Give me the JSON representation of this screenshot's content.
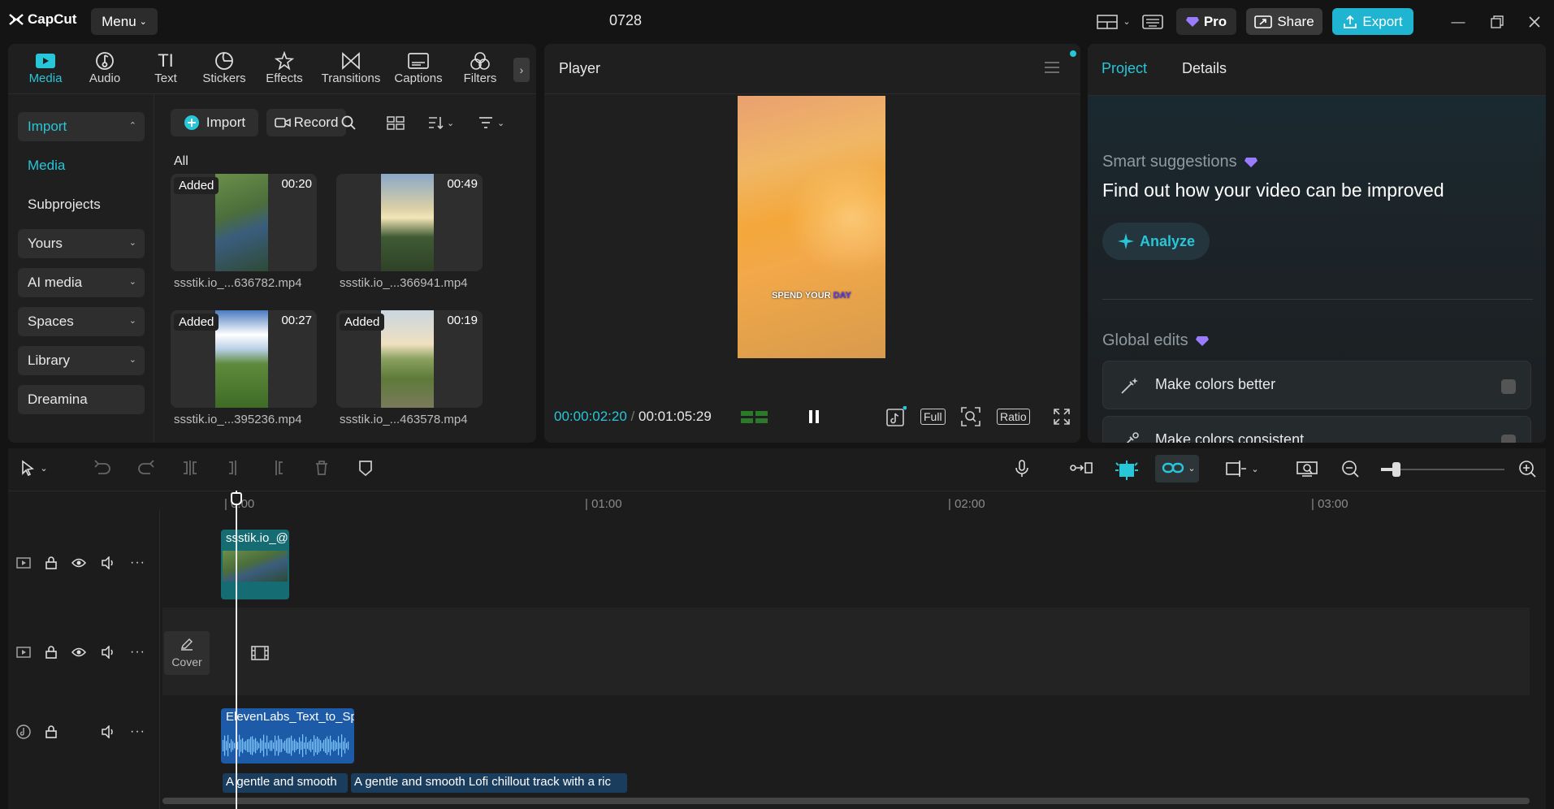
{
  "app": {
    "logo": "CapCut",
    "menu_label": "Menu",
    "project_title": "0728"
  },
  "header": {
    "pro_label": "Pro",
    "share_label": "Share",
    "export_label": "Export"
  },
  "tool_tabs": [
    {
      "label": "Media",
      "icon": "media-icon"
    },
    {
      "label": "Audio",
      "icon": "audio-icon"
    },
    {
      "label": "Text",
      "icon": "text-icon"
    },
    {
      "label": "Stickers",
      "icon": "stickers-icon"
    },
    {
      "label": "Effects",
      "icon": "effects-icon"
    },
    {
      "label": "Transitions",
      "icon": "transitions-icon"
    },
    {
      "label": "Captions",
      "icon": "captions-icon"
    },
    {
      "label": "Filters",
      "icon": "filters-icon"
    }
  ],
  "sidebar": {
    "items": [
      {
        "label": "Import"
      },
      {
        "label": "Media"
      },
      {
        "label": "Subprojects"
      },
      {
        "label": "Yours"
      },
      {
        "label": "AI media"
      },
      {
        "label": "Spaces"
      },
      {
        "label": "Library"
      },
      {
        "label": "Dreamina"
      }
    ]
  },
  "media": {
    "import_label": "Import",
    "record_label": "Record",
    "filter_all": "All",
    "items": [
      {
        "badge": "Added",
        "duration": "00:20",
        "name": "ssstik.io_...636782.mp4"
      },
      {
        "badge": "",
        "duration": "00:49",
        "name": "ssstik.io_...366941.mp4"
      },
      {
        "badge": "Added",
        "duration": "00:27",
        "name": "ssstik.io_...395236.mp4"
      },
      {
        "badge": "Added",
        "duration": "00:19",
        "name": "ssstik.io_...463578.mp4"
      }
    ]
  },
  "player": {
    "title": "Player",
    "caption_a": "SPEND YOUR",
    "caption_b": "DAY",
    "current_time": "00:00:02:20",
    "total_time": "00:01:05:29",
    "full_label": "Full",
    "ratio_label": "Ratio"
  },
  "right_panel": {
    "tab_project": "Project",
    "tab_details": "Details",
    "smart_title": "Smart suggestions",
    "smart_headline": "Find out how your video can be improved",
    "analyze_label": "Analyze",
    "global_title": "Global edits",
    "edits": [
      {
        "label": "Make colors better"
      },
      {
        "label": "Make colors consistent"
      }
    ]
  },
  "timeline": {
    "ruler": [
      "| 0:00",
      "| 01:00",
      "| 02:00",
      "| 03:00"
    ],
    "video_clip_label": "ssstik.io_@",
    "cover_label": "Cover",
    "audio_clip_label": "ElevenLabs_Text_to_Sp",
    "text_clip_1": "A gentle and smooth",
    "text_clip_2": "A gentle and smooth Lofi chillout track with a ric"
  },
  "colors": {
    "accent": "#27c6d8",
    "pro_purple": "#9b7bff",
    "audio_clip": "#1d5aa8",
    "video_clip": "#156c73"
  }
}
